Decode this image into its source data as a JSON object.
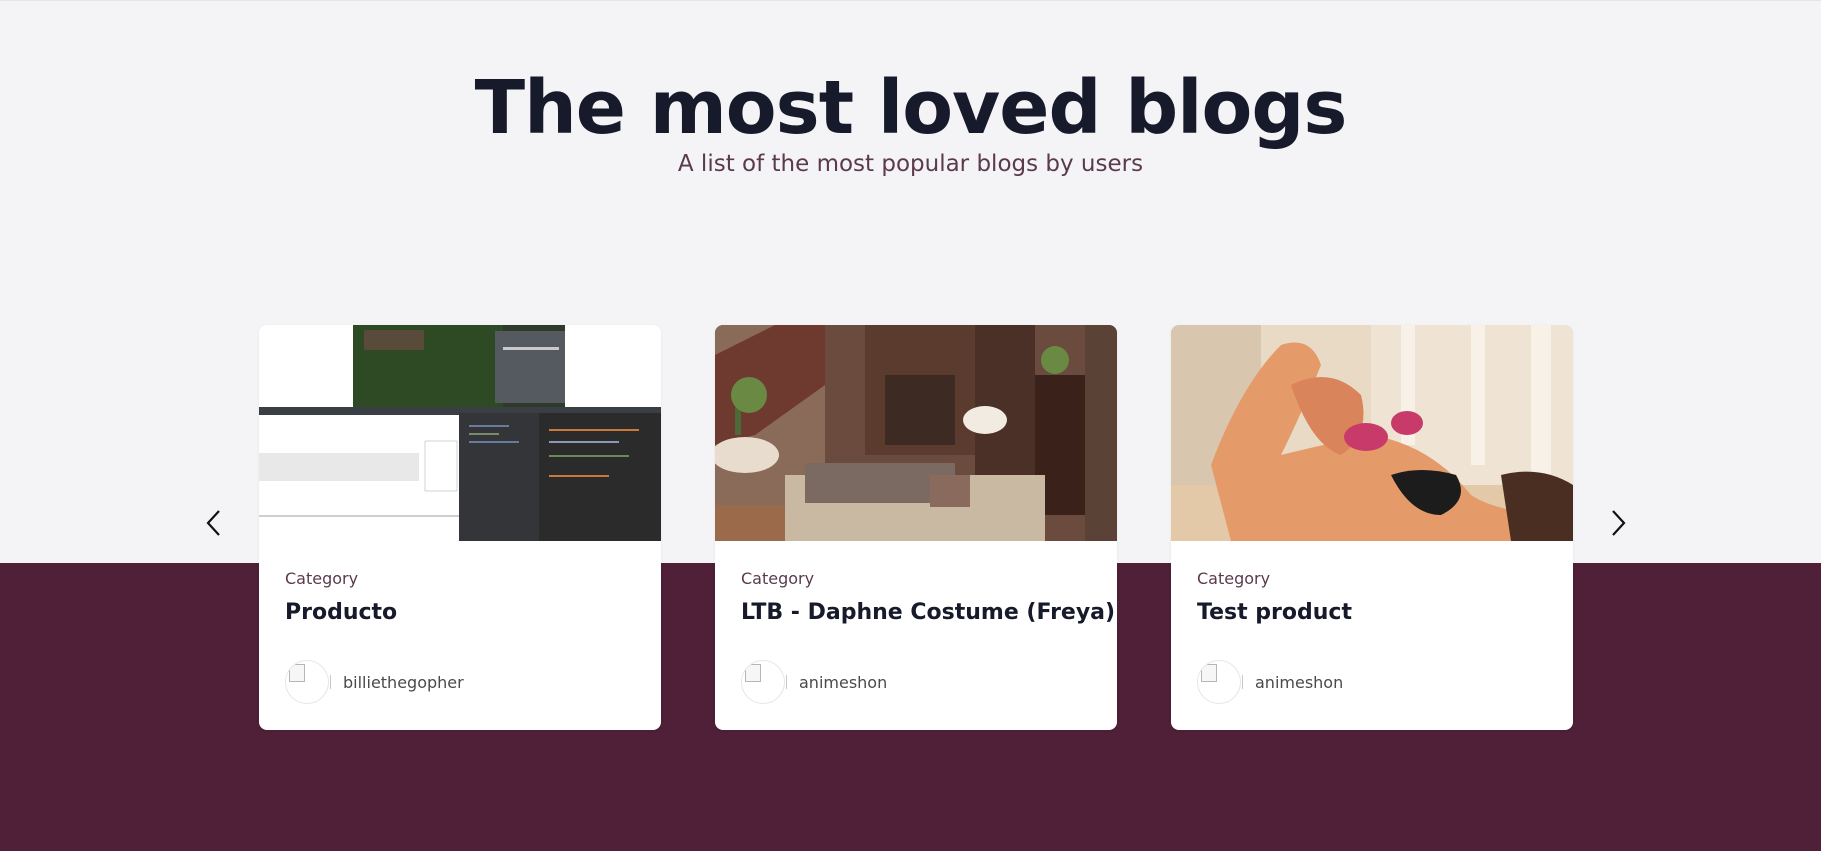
{
  "section": {
    "title": "The most loved blogs",
    "subtitle": "A list of the most popular blogs by users"
  },
  "carousel": {
    "prev_icon": "chevron-left-icon",
    "next_icon": "chevron-right-icon"
  },
  "cards": [
    {
      "category": "Category",
      "title": "Producto",
      "author": "billiethegopher",
      "image": "screenshot of game editor and code"
    },
    {
      "category": "Category",
      "title": "LTB - Daphne Costume (Freya)",
      "author": "animeshon",
      "image": "cozy living room render"
    },
    {
      "category": "Category",
      "title": "Test product",
      "author": "animeshon",
      "image": "3d character render with pink shoes"
    }
  ],
  "colors": {
    "background": "#f4f4f7",
    "band": "#4f2038",
    "heading": "#161a2a",
    "accent_text": "#5a3a4c"
  }
}
